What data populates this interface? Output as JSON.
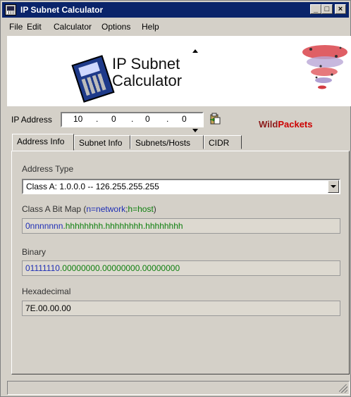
{
  "window": {
    "title": "IP Subnet Calculator",
    "controls": {
      "minimize": "_",
      "maximize": "□",
      "close": "×"
    }
  },
  "menu": [
    "File",
    "Edit",
    "Calculator",
    "Options",
    "Help"
  ],
  "banner": {
    "title_line1": "IP Subnet",
    "title_line2": "Calculator",
    "brand_wild": "Wild",
    "brand_packets": "Packets"
  },
  "ip": {
    "label": "IP Address",
    "octets": [
      "10",
      "0",
      "0",
      "0"
    ],
    "dot": "."
  },
  "tabs": [
    "Address Info",
    "Subnet Info",
    "Subnets/Hosts",
    "CIDR"
  ],
  "address_info": {
    "address_type_label": "Address Type",
    "address_type_value": "Class A: 1.0.0.0 -- 126.255.255.255",
    "bitmap_label_prefix": "Class A Bit Map (",
    "bitmap_label_network": "n=network",
    "bitmap_label_sep": ";",
    "bitmap_label_host": "h=host",
    "bitmap_label_suffix": ")",
    "bitmap_network": "0nnnnnnn",
    "bitmap_host": ".hhhhhhhh.hhhhhhhh.hhhhhhhh",
    "binary_label": "Binary",
    "binary_network": "01111110",
    "binary_host": ".00000000.00000000.00000000",
    "hex_label": "Hexadecimal",
    "hex_value": "7E.00.00.00"
  },
  "colors": {
    "titlebar": "#0a246a",
    "network_bits": "#1f2fb5",
    "host_bits": "#0e7f0e"
  }
}
